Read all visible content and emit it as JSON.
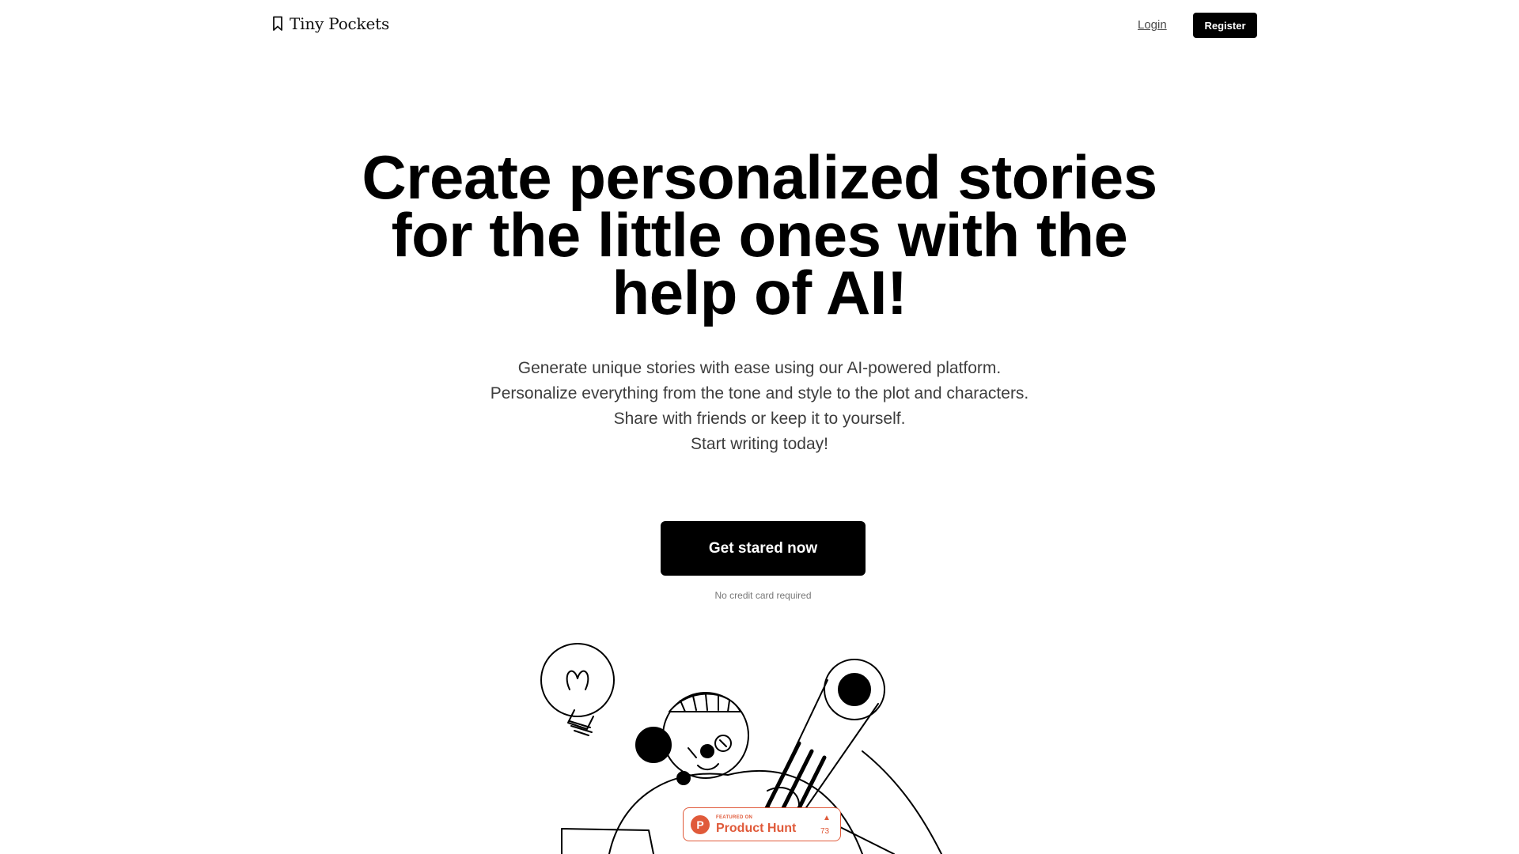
{
  "nav": {
    "brand_name": "Tiny Pockets",
    "brand_icon": "bookmark-icon",
    "login_label": "Login",
    "register_label": "Register"
  },
  "hero": {
    "title": "Create personalized stories for the little ones with the help of AI!",
    "subtitle_lines": [
      "Generate unique stories with ease using our AI-powered platform.",
      "Personalize everything from the tone and style to the plot and characters.",
      "Share with friends or keep it to yourself.",
      "Start writing today!"
    ],
    "cta_label": "Get stared now",
    "cta_note": "No credit card required"
  },
  "product_hunt": {
    "featured_label": "FEATURED ON",
    "name": "Product Hunt",
    "upvote_icon": "triangle-up-icon",
    "upvotes": "73",
    "color": "#e05a3a"
  },
  "colors": {
    "primary": "#000000",
    "background": "#ffffff",
    "text_muted": "#3d3d3d"
  }
}
